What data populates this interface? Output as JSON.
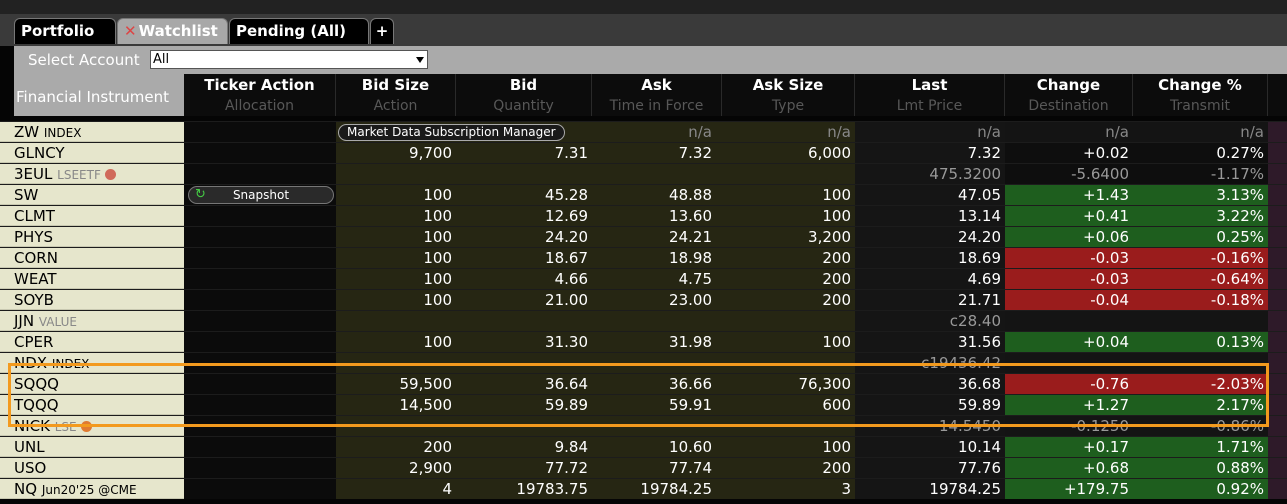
{
  "tabs": [
    {
      "label": "Portfolio",
      "active": false
    },
    {
      "label": "Watchlist",
      "active": true,
      "close": "✕"
    },
    {
      "label": "Pending (All)",
      "active": false
    },
    {
      "label": "+",
      "active": false
    }
  ],
  "account": {
    "label": "Select Account",
    "value": "All"
  },
  "columns": {
    "financial_instrument": "Financial Instrument",
    "ticker_action": {
      "top": "Ticker Action",
      "bottom": "Allocation"
    },
    "bid_size": {
      "top": "Bid Size",
      "bottom": "Action"
    },
    "bid": {
      "top": "Bid",
      "bottom": "Quantity"
    },
    "ask": {
      "top": "Ask",
      "bottom": "Time in Force"
    },
    "ask_size": {
      "top": "Ask Size",
      "bottom": "Type"
    },
    "last": {
      "top": "Last",
      "bottom": "Lmt Price"
    },
    "change": {
      "top": "Change",
      "bottom": "Destination"
    },
    "change_pct": {
      "top": "Change %",
      "bottom": "Transmit"
    }
  },
  "buttons": {
    "mdsm": "Market Data Subscription Manager",
    "snapshot": "Snapshot"
  },
  "rows": [
    {
      "sym": "ZW",
      "sub": "INDEX",
      "sub_style": "dark",
      "bid_size": "",
      "bid": "",
      "ask": "n/a",
      "ask_size": "n/a",
      "last": "n/a",
      "change": "n/a",
      "change_pct": "n/a",
      "tone": "neu",
      "mdsm": true
    },
    {
      "sym": "GLNCY",
      "sub": "",
      "bid_size": "9,700",
      "bid": "7.31",
      "ask": "7.32",
      "ask_size": "6,000",
      "last": "7.32",
      "change": "+0.02",
      "change_pct": "0.27%",
      "tone": "dk",
      "bm": "w",
      "am": "w",
      "lm": "w"
    },
    {
      "sym": "3EUL",
      "sub": "LSEETF",
      "sub_style": "gray",
      "dot": "#d06a5a",
      "bid_size": "",
      "bid": "",
      "ask": "",
      "ask_size": "",
      "last": "475.3200",
      "change": "-5.6400",
      "change_pct": "-1.17%",
      "tone": "dk",
      "gray": true,
      "lm": "w"
    },
    {
      "sym": "SW",
      "sub": "",
      "bid_size": "100",
      "bid": "45.28",
      "ask": "48.88",
      "ask_size": "100",
      "last": "47.05",
      "change": "+1.43",
      "change_pct": "3.13%",
      "tone": "pos",
      "bm": "rd",
      "am": "gr",
      "lm": "gr",
      "snapshot": true
    },
    {
      "sym": "CLMT",
      "sub": "",
      "bid_size": "100",
      "bid": "12.69",
      "ask": "13.60",
      "ask_size": "100",
      "last": "13.14",
      "change": "+0.41",
      "change_pct": "3.22%",
      "tone": "pos",
      "bm": "rd",
      "am": "gr",
      "lm": "rd"
    },
    {
      "sym": "PHYS",
      "sub": "",
      "bid_size": "100",
      "bid": "24.20",
      "ask": "24.21",
      "ask_size": "3,200",
      "last": "24.20",
      "change": "+0.06",
      "change_pct": "0.25%",
      "tone": "pos",
      "bm": "gr",
      "am": "rd",
      "lm": "rd"
    },
    {
      "sym": "CORN",
      "sub": "",
      "bid_size": "100",
      "bid": "18.67",
      "ask": "18.98",
      "ask_size": "200",
      "last": "18.69",
      "change": "-0.03",
      "change_pct": "-0.16%",
      "tone": "neg",
      "bm": "rd",
      "am": "gr",
      "lm": "rd"
    },
    {
      "sym": "WEAT",
      "sub": "",
      "bid_size": "100",
      "bid": "4.66",
      "ask": "4.75",
      "ask_size": "200",
      "last": "4.69",
      "change": "-0.03",
      "change_pct": "-0.64%",
      "tone": "neg",
      "bm": "rd",
      "am": "gr",
      "lm": "rd"
    },
    {
      "sym": "SOYB",
      "sub": "",
      "bid_size": "100",
      "bid": "21.00",
      "ask": "23.00",
      "ask_size": "200",
      "last": "21.71",
      "change": "-0.04",
      "change_pct": "-0.18%",
      "tone": "neg",
      "bm": "rd",
      "am": "gr",
      "lm": "rd"
    },
    {
      "sym": "JJN",
      "sub": "VALUE",
      "sub_style": "gray",
      "bid_size": "",
      "bid": "",
      "ask": "",
      "ask_size": "",
      "last": "c28.40",
      "change": "",
      "change_pct": "",
      "tone": "neu",
      "gray": true,
      "lm": "w"
    },
    {
      "sym": "CPER",
      "sub": "",
      "bid_size": "100",
      "bid": "31.30",
      "ask": "31.98",
      "ask_size": "100",
      "last": "31.56",
      "change": "+0.04",
      "change_pct": "0.13%",
      "tone": "pos",
      "bm": "rd",
      "am": "gr",
      "lm": "rd"
    },
    {
      "sym": "NDX",
      "sub": "INDEX",
      "sub_style": "dark",
      "bid_size": "",
      "bid": "",
      "ask": "",
      "ask_size": "",
      "last": "c19436.42",
      "change": "",
      "change_pct": "",
      "tone": "neu",
      "gray": true
    },
    {
      "sym": "SQQQ",
      "sub": "",
      "bid_size": "59,500",
      "bid": "36.64",
      "ask": "36.66",
      "ask_size": "76,300",
      "last": "36.68",
      "change": "-0.76",
      "change_pct": "-2.03%",
      "tone": "neg",
      "bm": "rd",
      "am": "gr",
      "lm": "gr"
    },
    {
      "sym": "TQQQ",
      "sub": "",
      "bid_size": "14,500",
      "bid": "59.89",
      "ask": "59.91",
      "ask_size": "600",
      "last": "59.89",
      "change": "+1.27",
      "change_pct": "2.17%",
      "tone": "pos",
      "bm": "rd",
      "am": "gr",
      "lm": "gy"
    },
    {
      "sym": "NICK",
      "sub": "LSE",
      "sub_style": "gray",
      "dot": "#e07a30",
      "bid_size": "",
      "bid": "",
      "ask": "",
      "ask_size": "",
      "last": "14.5450",
      "change": "-0.1250",
      "change_pct": "-0.86%",
      "tone": "neu",
      "gray": true,
      "lm": "w"
    },
    {
      "sym": "UNL",
      "sub": "",
      "bid_size": "200",
      "bid": "9.84",
      "ask": "10.60",
      "ask_size": "100",
      "last": "10.14",
      "change": "+0.17",
      "change_pct": "1.71%",
      "tone": "pos",
      "bm": "rd",
      "am": "gr",
      "lm": "rd"
    },
    {
      "sym": "USO",
      "sub": "",
      "bid_size": "2,900",
      "bid": "77.72",
      "ask": "77.74",
      "ask_size": "200",
      "last": "77.76",
      "change": "+0.68",
      "change_pct": "0.88%",
      "tone": "pos",
      "bm": "rd",
      "am": "gr",
      "lm": "gr"
    },
    {
      "sym": "NQ",
      "sub": "Jun20'25 @CME",
      "sub_style": "dark",
      "bid_size": "4",
      "bid": "19783.75",
      "ask": "19784.25",
      "ask_size": "3",
      "last": "19784.25",
      "change": "+179.75",
      "change_pct": "0.92%",
      "tone": "pos",
      "bm": "w",
      "am": "w",
      "lm": "w"
    }
  ],
  "colors": {
    "positive": "#1e5e1e",
    "negative": "#9a1c1c",
    "highlight": "#f39a1e",
    "instrument_bg": "#e6e6cc"
  }
}
